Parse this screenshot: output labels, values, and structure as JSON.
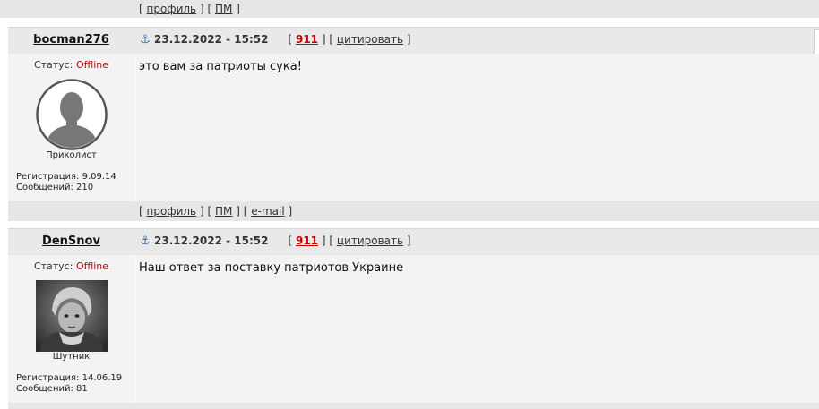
{
  "top_bar": {
    "bracket_open": "[",
    "bracket_close": "]",
    "profile": "профиль",
    "pm": "ПМ",
    "email": "e-mail"
  },
  "posts": [
    {
      "username": "bocman276",
      "date": "23.12.2022 - 15:52",
      "number": "911",
      "quote": "цитировать",
      "status_label": "Статус:",
      "status_value": "Offline",
      "rank": "Приколист",
      "reg_label": "Регистрация: 9.09.14",
      "msgs_label": "Сообщений: 210",
      "avatar": "default-avatar-icon",
      "message": "это вам за патриоты сука!"
    },
    {
      "username": "DenSnov",
      "date": "23.12.2022 - 15:52",
      "number": "911",
      "quote": "цитировать",
      "status_label": "Статус:",
      "status_value": "Offline",
      "rank": "Шутник",
      "reg_label": "Регистрация: 14.06.19",
      "msgs_label": "Сообщений: 81",
      "avatar": "photo-avatar",
      "message": "Наш ответ за поставку патриотов Украине"
    }
  ],
  "colors": {
    "offline": "#b01010",
    "post_number": "#cc0000",
    "anchor": "#3b6ea5"
  }
}
